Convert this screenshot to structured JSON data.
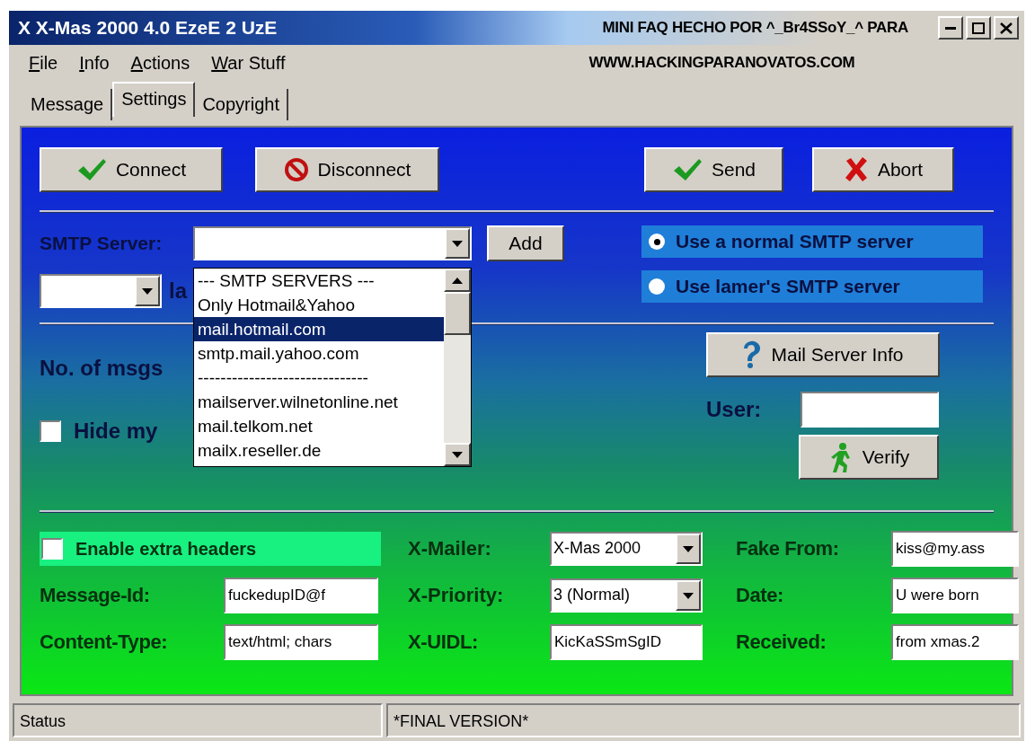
{
  "window": {
    "title": "X X-Mas 2000 4.0 EzeE 2 UzE"
  },
  "faq_note": [
    "MINI FAQ HECHO POR ^_Br4SSoY_^ PARA",
    "WWW.HACKINGPARANOVATOS.COM"
  ],
  "menu": [
    "File",
    "Info",
    "Actions",
    "War Stuff"
  ],
  "tabs": [
    {
      "label": "Message",
      "selected": false
    },
    {
      "label": "Settings",
      "selected": true
    },
    {
      "label": "Copyright",
      "selected": false
    }
  ],
  "left_buttons": [
    {
      "label": "Connect",
      "kind": "check"
    },
    {
      "label": "Disconnect",
      "kind": "stop"
    }
  ],
  "right_buttons": [
    {
      "label": "Send",
      "kind": "check"
    },
    {
      "label": "Abort",
      "kind": "cross"
    }
  ],
  "smtp": {
    "label": "SMTP Server:",
    "add_button": "Add",
    "list": [
      {
        "label": "--- SMTP SERVERS ---",
        "selected": false
      },
      {
        "label": "Only Hotmail&Yahoo",
        "selected": false
      },
      {
        "label": "mail.hotmail.com",
        "selected": true
      },
      {
        "label": "smtp.mail.yahoo.com",
        "selected": false
      },
      {
        "label": "------------------------------",
        "selected": false
      },
      {
        "label": "mailserver.wilnetonline.net",
        "selected": false
      },
      {
        "label": "mail.telkom.net",
        "selected": false
      },
      {
        "label": "mailx.reseller.de",
        "selected": false
      }
    ]
  },
  "second_combo_label": "la",
  "server_mode": [
    {
      "label": "Use a normal SMTP server",
      "selected": true
    },
    {
      "label": "Use lamer's SMTP server",
      "selected": false
    }
  ],
  "messages_label": "No. of msgs",
  "hide_option": {
    "label": "Hide my",
    "checked": false
  },
  "mail_server_info_button": "Mail Server Info",
  "user": {
    "label": "User:"
  },
  "verify_button": "Verify",
  "extra_headers": [
    {
      "kind": "checkbox",
      "label": "Enable extra headers",
      "checked": false
    },
    {
      "kind": "combo",
      "label": "X-Mailer:",
      "value": "X-Mas 2000"
    },
    {
      "kind": "text",
      "label": "Fake From:",
      "value": "kiss@my.ass"
    },
    {
      "kind": "text",
      "label": "Message-Id:",
      "value": "fuckedupID@f"
    },
    {
      "kind": "combo",
      "label": "X-Priority:",
      "value": "3 (Normal)"
    },
    {
      "kind": "text",
      "label": "Date:",
      "value": "U were born"
    },
    {
      "kind": "text",
      "label": "Content-Type:",
      "value": "text/html; chars"
    },
    {
      "kind": "text",
      "label": "X-UIDL:",
      "value": "KicKaSSmSgID"
    },
    {
      "kind": "text",
      "label": "Received:",
      "value": "from xmas.2"
    }
  ],
  "status_bar": [
    "Status",
    "*FINAL VERSION*"
  ]
}
